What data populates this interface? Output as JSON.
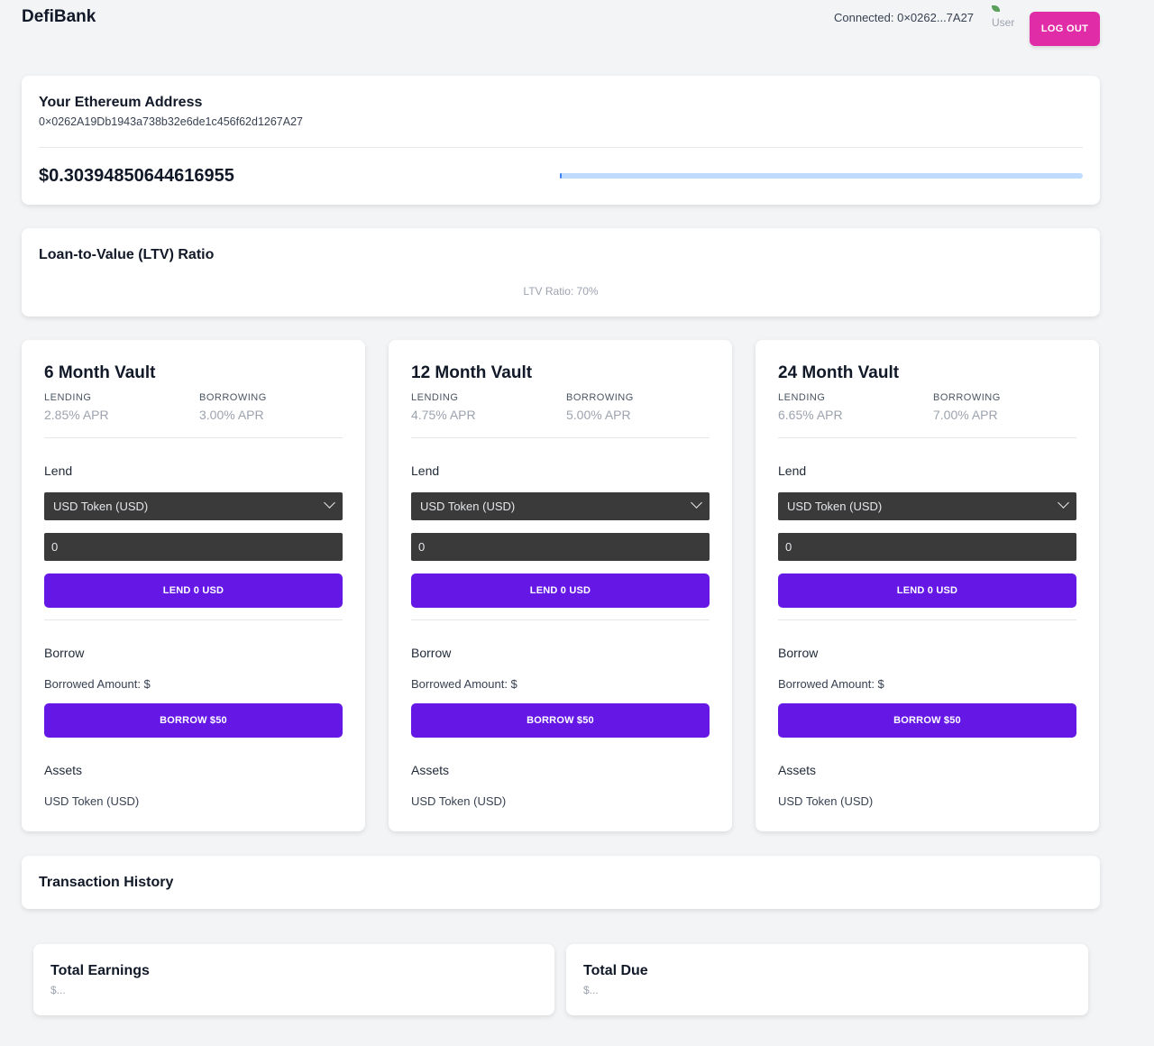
{
  "header": {
    "brand": "DefiBank",
    "connected": "Connected: 0×0262...7A27",
    "user_alt": "User",
    "logout_label": "LOG OUT"
  },
  "account": {
    "title": "Your Ethereum Address",
    "address": "0×0262A19Db1943a738b32e6de1c456f62d1267A27",
    "balance": "$0.30394850644616955",
    "progress_fraction": 0.004
  },
  "ltv": {
    "title": "Loan-to-Value (LTV) Ratio",
    "ratio_text": "LTV Ratio: 70%"
  },
  "vaults": [
    {
      "title": "6 Month Vault",
      "lending_label": "LENDING",
      "lending_apr": "2.85% APR",
      "borrowing_label": "BORROWING",
      "borrowing_apr": "3.00% APR",
      "lend_label": "Lend",
      "token_select": "USD Token (USD)",
      "amount": "0",
      "lend_button": "LEND 0 USD",
      "borrow_label": "Borrow",
      "borrowed_amount": "Borrowed Amount: $",
      "borrow_button": "BORROW $50",
      "assets_label": "Assets",
      "asset": "USD Token (USD)"
    },
    {
      "title": "12 Month Vault",
      "lending_label": "LENDING",
      "lending_apr": "4.75% APR",
      "borrowing_label": "BORROWING",
      "borrowing_apr": "5.00% APR",
      "lend_label": "Lend",
      "token_select": "USD Token (USD)",
      "amount": "0",
      "lend_button": "LEND 0 USD",
      "borrow_label": "Borrow",
      "borrowed_amount": "Borrowed Amount: $",
      "borrow_button": "BORROW $50",
      "assets_label": "Assets",
      "asset": "USD Token (USD)"
    },
    {
      "title": "24 Month Vault",
      "lending_label": "LENDING",
      "lending_apr": "6.65% APR",
      "borrowing_label": "BORROWING",
      "borrowing_apr": "7.00% APR",
      "lend_label": "Lend",
      "token_select": "USD Token (USD)",
      "amount": "0",
      "lend_button": "LEND 0 USD",
      "borrow_label": "Borrow",
      "borrowed_amount": "Borrowed Amount: $",
      "borrow_button": "BORROW $50",
      "assets_label": "Assets",
      "asset": "USD Token (USD)"
    }
  ],
  "transactions": {
    "title": "Transaction History"
  },
  "totals": {
    "earnings_title": "Total Earnings",
    "earnings_value": "$...",
    "due_title": "Total Due",
    "due_value": "$..."
  },
  "colors": {
    "logout": "#e12ca8",
    "action_button": "#6517e6",
    "input_bg": "#3a3a3a",
    "progress_track": "#bfdbfe"
  }
}
